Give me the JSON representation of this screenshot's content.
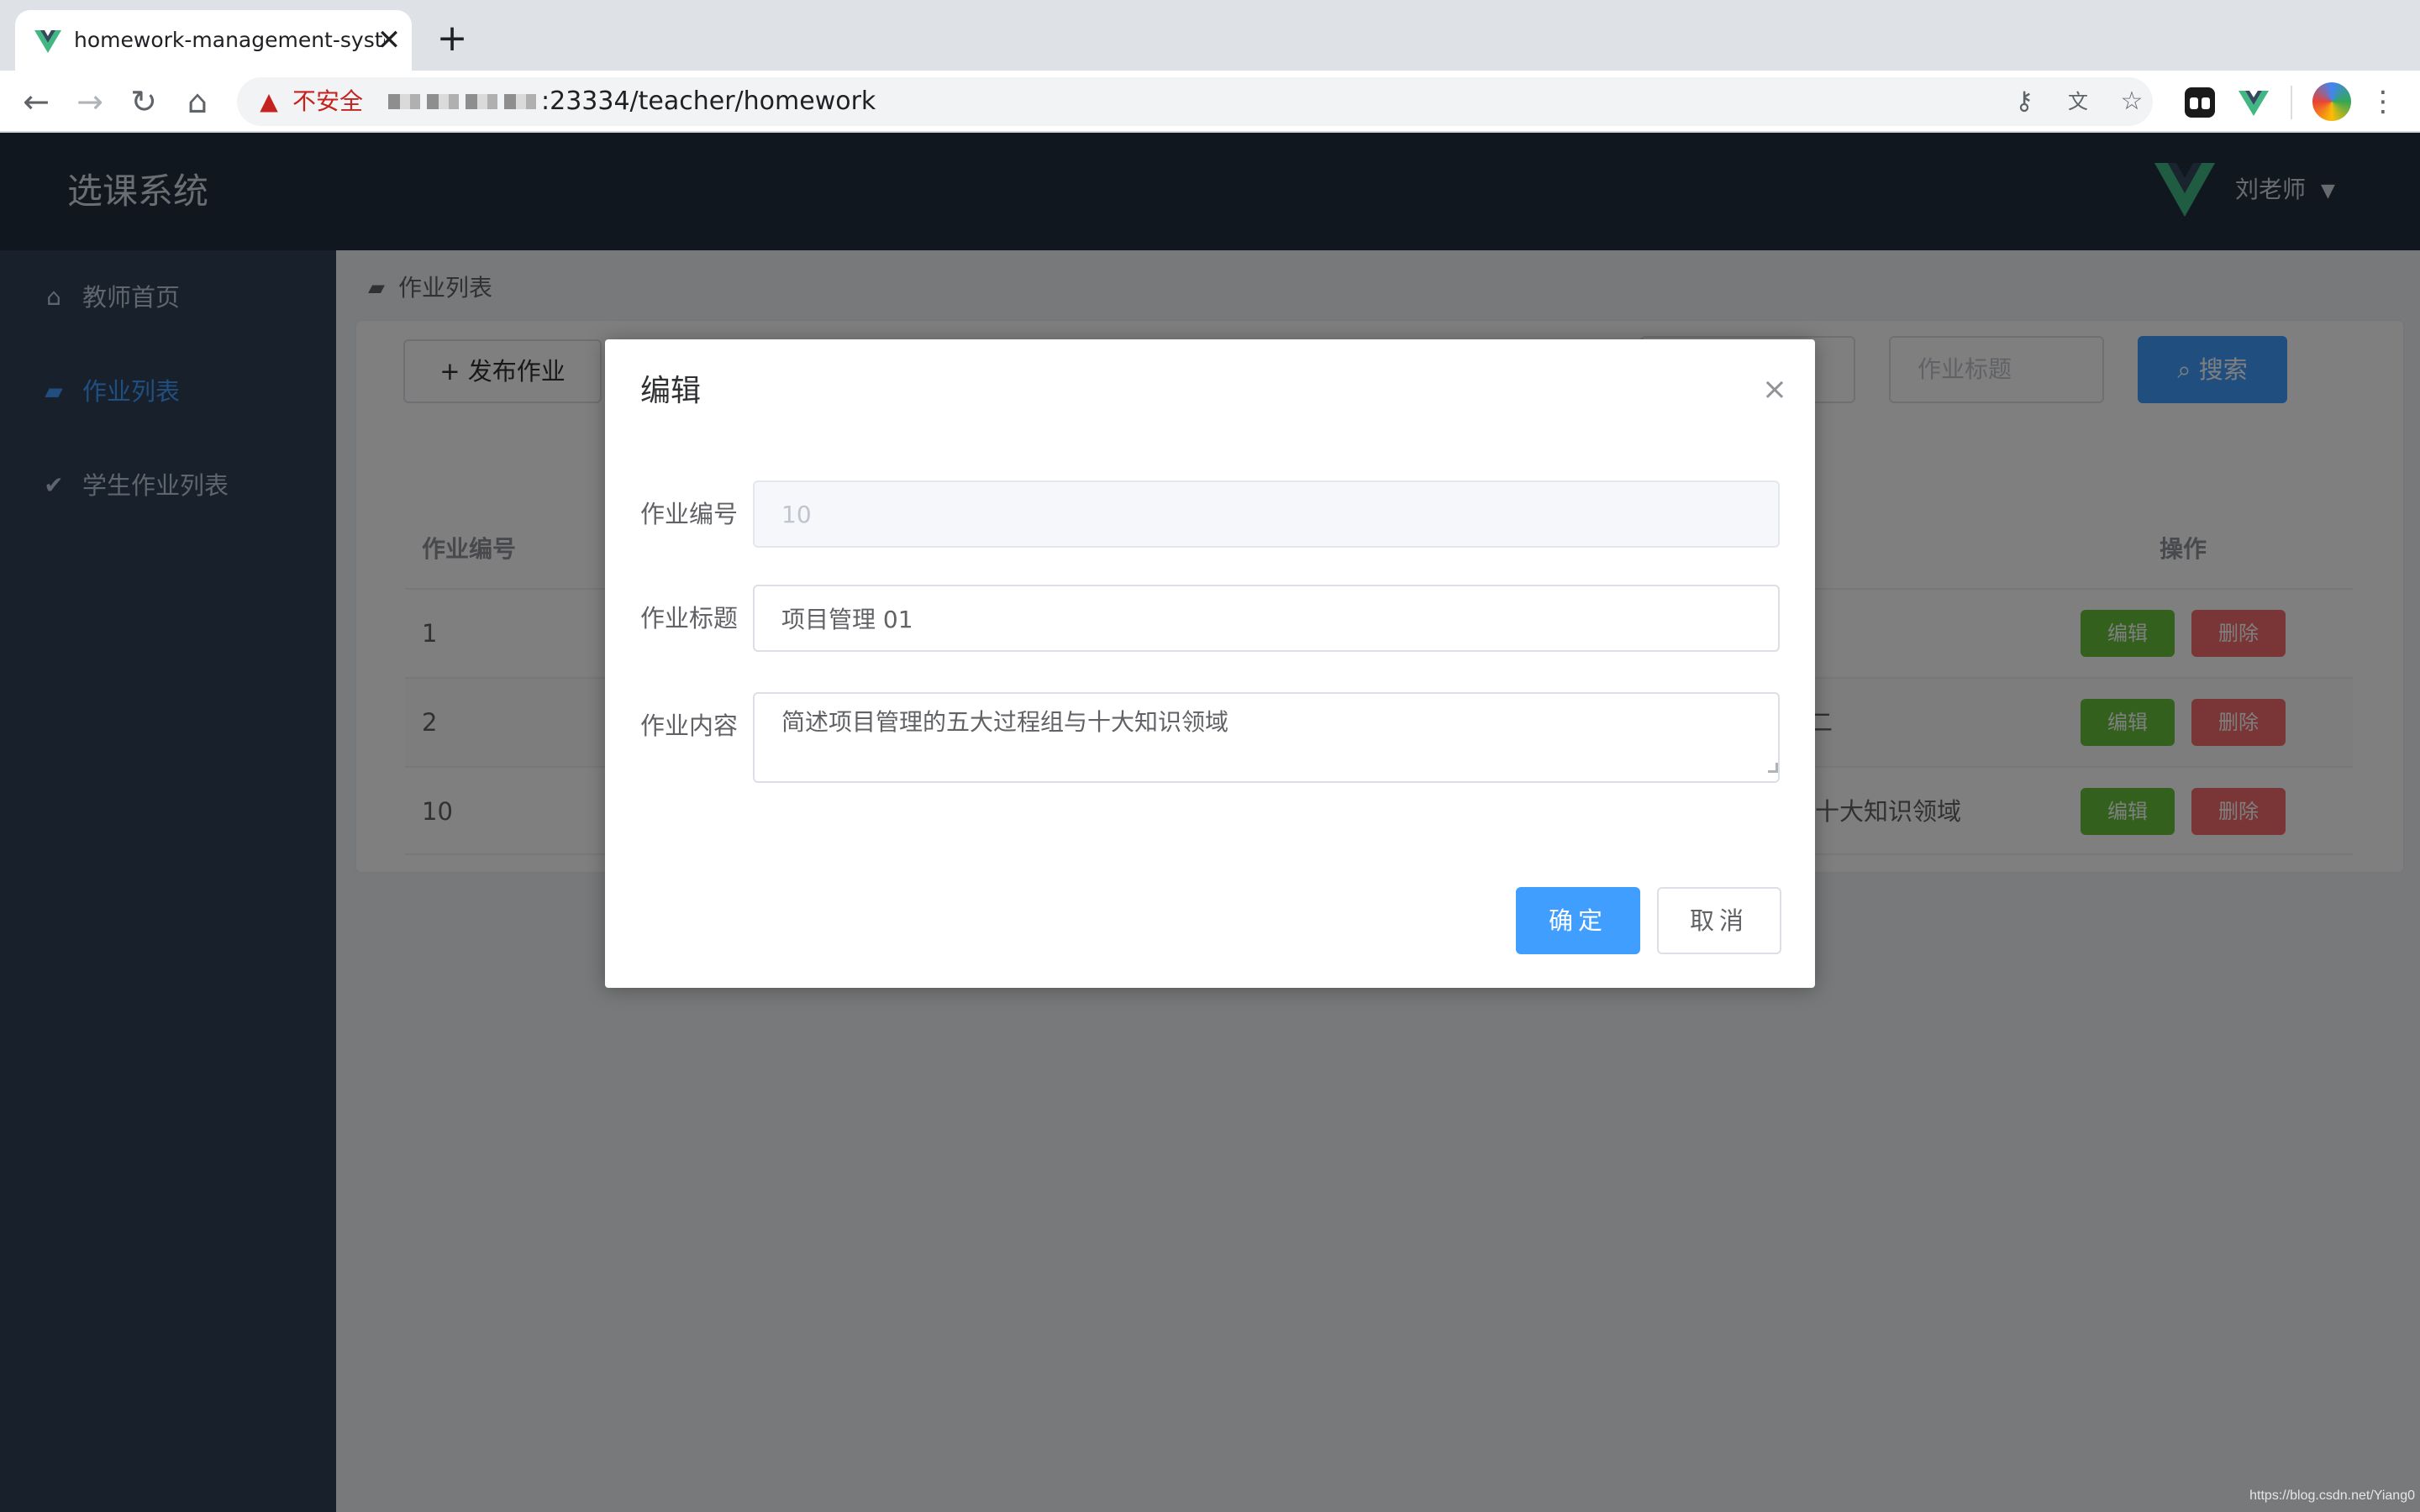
{
  "browser": {
    "tab_title": "homework-management-system",
    "tab_close": "✕",
    "new_tab": "+",
    "insecure_label": "不安全",
    "url": ":23334/teacher/homework"
  },
  "app": {
    "title": "选课系统",
    "user_name": "刘老师"
  },
  "sidebar": {
    "items": [
      {
        "label": "教师首页",
        "icon": "home-icon",
        "active": false
      },
      {
        "label": "作业列表",
        "icon": "book-icon",
        "active": true
      },
      {
        "label": "学生作业列表",
        "icon": "check-icon",
        "active": false
      }
    ]
  },
  "breadcrumb": {
    "label": "作业列表"
  },
  "toolbar": {
    "publish_label": "+ 发布作业",
    "title_placeholder": "作业标题",
    "search_label": "搜索"
  },
  "table": {
    "headers": {
      "id": "作业编号",
      "actions": "操作"
    },
    "rows": [
      {
        "id": "1",
        "content_tail": ""
      },
      {
        "id": "2",
        "content_tail": "二"
      },
      {
        "id": "10",
        "content_tail": "十大知识领域"
      }
    ],
    "edit_label": "编辑",
    "delete_label": "删除"
  },
  "dialog": {
    "title": "编辑",
    "close": "×",
    "fields": {
      "id": {
        "label": "作业编号",
        "value": "10"
      },
      "title": {
        "label": "作业标题",
        "value": "项目管理 01"
      },
      "content": {
        "label": "作业内容",
        "value": "简述项目管理的五大过程组与十大知识领域"
      }
    },
    "confirm_label": "确定",
    "cancel_label": "取消"
  },
  "watermark": "https://blog.csdn.net/Yiang0",
  "colors": {
    "primary": "#409eff",
    "success": "#67c23a",
    "danger": "#f56c6c",
    "header_bg": "#232f3e",
    "sidebar_bg": "#304156"
  }
}
